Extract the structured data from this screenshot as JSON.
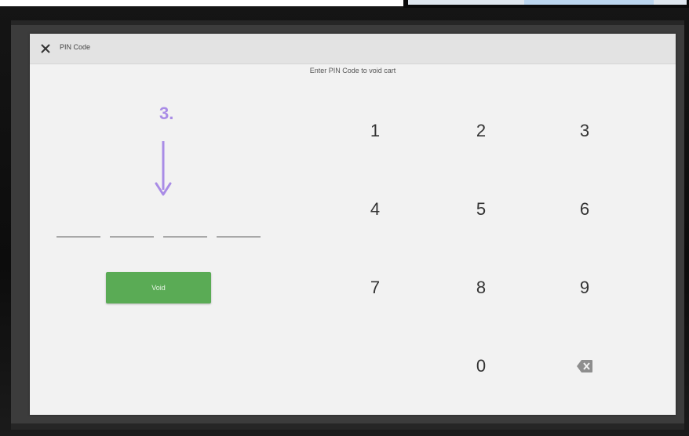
{
  "dialog": {
    "title": "PIN Code",
    "prompt": "Enter PIN Code to void cart",
    "go_button_label": "Void"
  },
  "pin": {
    "slot_count": 4,
    "value": ""
  },
  "keypad": {
    "keys": [
      "1",
      "2",
      "3",
      "4",
      "5",
      "6",
      "7",
      "8",
      "9",
      "0"
    ],
    "icons": {
      "close": "close-icon",
      "backspace": "backspace-icon"
    }
  },
  "annotation": {
    "step_label": "3.",
    "color": "#a98ce6"
  },
  "colors": {
    "go_button": "#5aab55",
    "dialog_bg": "#f2f2f2",
    "titlebar_bg": "#e3e3e3"
  }
}
